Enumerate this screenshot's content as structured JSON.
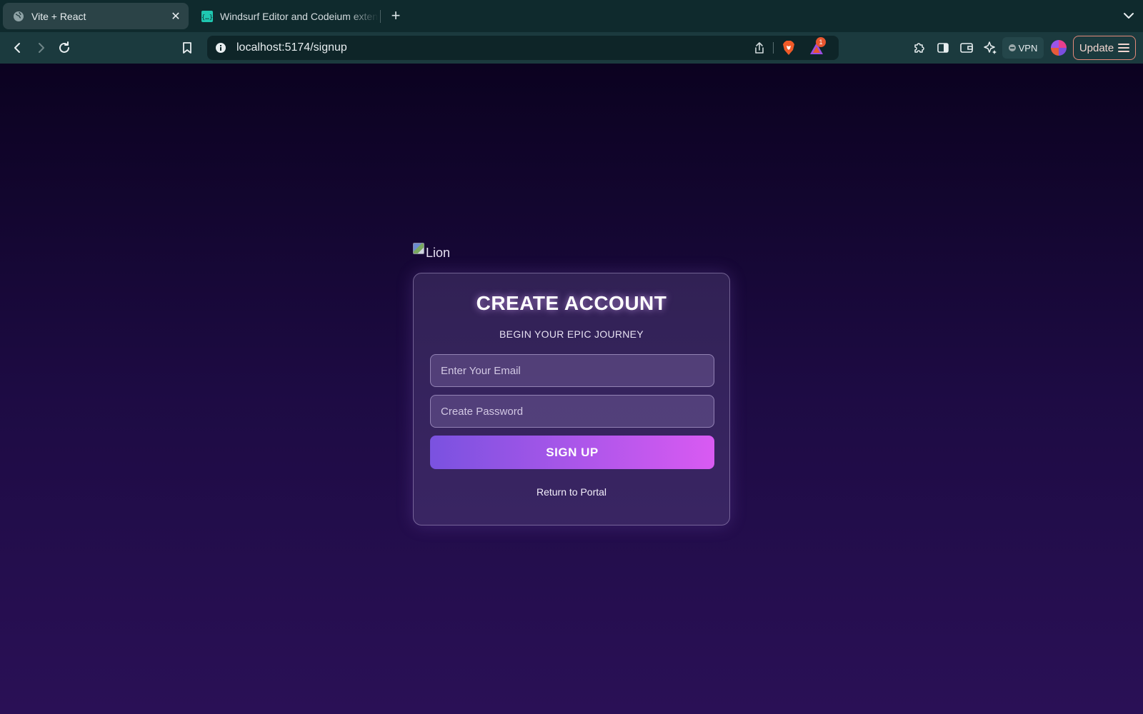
{
  "browser": {
    "tabs": [
      {
        "title": "Vite + React",
        "active": true,
        "icon": "globe-icon"
      },
      {
        "title": "Windsurf Editor and Codeium extensions",
        "active": false,
        "icon": "windsurf-icon"
      }
    ],
    "close_tab_glyph": "✕",
    "new_tab_glyph": "+",
    "url": "localhost:5174/signup",
    "rewards_badge": "1",
    "vpn_label": "VPN",
    "update_label": "Update"
  },
  "page": {
    "logo_alt": "Lion",
    "title": "CREATE ACCOUNT",
    "subtitle": "BEGIN YOUR EPIC JOURNEY",
    "email": {
      "placeholder": "Enter Your Email",
      "value": ""
    },
    "password": {
      "placeholder": "Create Password",
      "value": ""
    },
    "signup_label": "SIGN UP",
    "return_label": "Return to Portal"
  },
  "colors": {
    "chrome_tabbar": "#0f2a2d",
    "chrome_toolbar": "#1b3a3e",
    "page_bg_top": "#0b0220",
    "page_bg_bottom": "#2a1056",
    "button_gradient_start": "#7a52e0",
    "button_gradient_end": "#d95af2"
  }
}
